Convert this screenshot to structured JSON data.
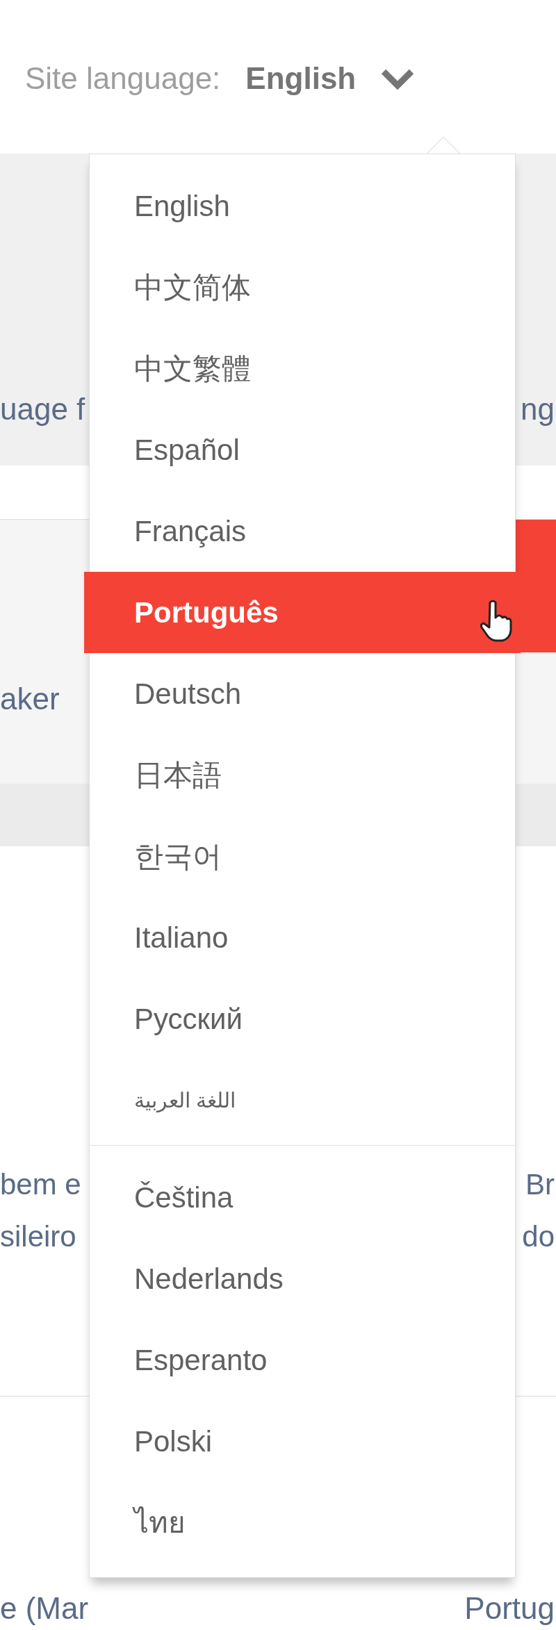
{
  "header": {
    "label": "Site language:",
    "value": "English"
  },
  "background": {
    "band_1": {
      "left": "uage f",
      "right": "ng"
    },
    "band_2": {
      "left": "aker"
    },
    "band_3": [
      {
        "left": "bem e",
        "right": "Br"
      },
      {
        "left": "sileiro",
        "right": "do"
      }
    ],
    "footer_line": [
      "e (Mar",
      "Portug"
    ]
  },
  "language_menu": [
    [
      {
        "label": "English",
        "selected": false
      },
      {
        "label": "中文简体",
        "selected": false
      },
      {
        "label": "中文繁體",
        "selected": false
      },
      {
        "label": "Español",
        "selected": false
      },
      {
        "label": "Français",
        "selected": false
      },
      {
        "label": "Português",
        "selected": true
      },
      {
        "label": "Deutsch",
        "selected": false
      },
      {
        "label": "日本語",
        "selected": false
      },
      {
        "label": "한국어",
        "selected": false
      },
      {
        "label": "Italiano",
        "selected": false
      },
      {
        "label": "Русский",
        "selected": false
      },
      {
        "label": "اللغة العربية",
        "selected": false,
        "kind": "small"
      }
    ],
    [
      {
        "label": "Čeština",
        "selected": false
      },
      {
        "label": "Nederlands",
        "selected": false
      },
      {
        "label": "Esperanto",
        "selected": false
      },
      {
        "label": "Polski",
        "selected": false
      },
      {
        "label": "ไทย",
        "selected": false
      }
    ]
  ]
}
